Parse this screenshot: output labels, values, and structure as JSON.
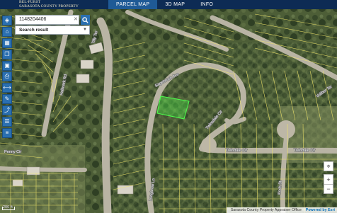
{
  "header": {
    "brand_line1": "BEL-FURST",
    "brand_line2": "SARASOTA COUNTY PROPERTY",
    "tabs": [
      {
        "label": "PARCEL MAP",
        "active": true
      },
      {
        "label": "3D MAP",
        "active": false
      },
      {
        "label": "INFO",
        "active": false
      }
    ]
  },
  "search": {
    "value": "1148204406",
    "clear_icon": "close-icon",
    "button_icon": "search-icon",
    "result_label": "Search result"
  },
  "left_toolbar": {
    "icons": [
      "layers-icon",
      "home-icon",
      "grid-icon",
      "bookmark-icon",
      "basemap-icon",
      "print-icon",
      "measure-icon",
      "draw-icon",
      "share-icon",
      "table-icon",
      "list-icon"
    ]
  },
  "right_toolbar": {
    "icons": [
      "locate-icon",
      "zoom-in-icon",
      "zoom-out-icon"
    ]
  },
  "map": {
    "road_labels": [
      "Penny Cir",
      "Hallmark Rd",
      "Sagebrush Ave",
      "Twinsdale Cir",
      "Twindale Cir",
      "Twindale Cir",
      "Longbrow Ln",
      "Tilly Ter",
      "Voliber Ter",
      "Koch St"
    ],
    "scale_label": "200 ft",
    "attribution": "Sarasota County Property Appraiser Office",
    "powered_by": "Powered by Esri",
    "selected_parcel_color": "#4cff4c"
  }
}
